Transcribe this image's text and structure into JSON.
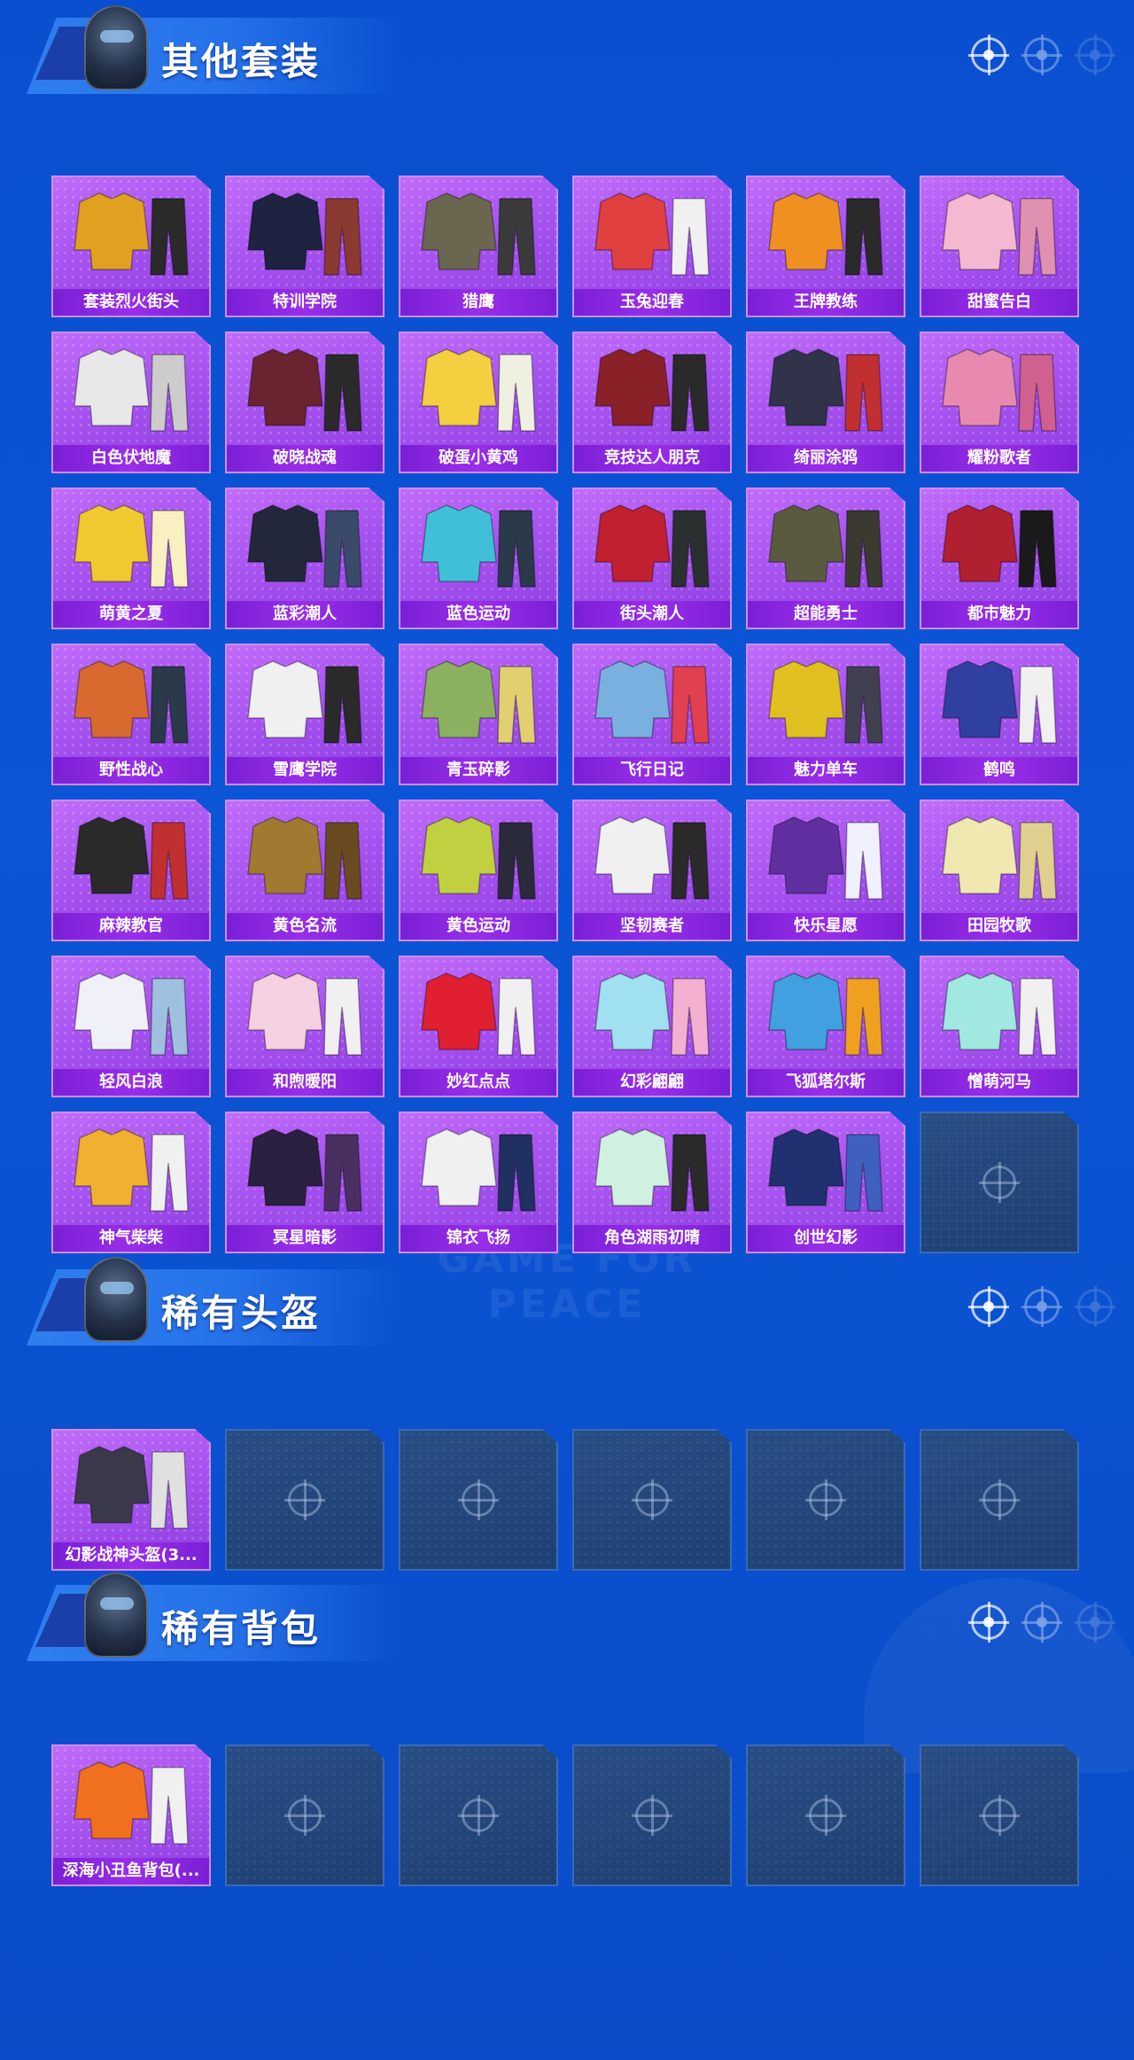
{
  "watermark": "GAME FOR PEACE",
  "sections": [
    {
      "title": "其他套装",
      "items": [
        {
          "name": "套装烈火街头",
          "colors": [
            "#e0a020",
            "#2a2a2a"
          ]
        },
        {
          "name": "特训学院",
          "colors": [
            "#1d2340",
            "#8a3a30"
          ]
        },
        {
          "name": "猎鹰",
          "colors": [
            "#6b6650",
            "#3a3a3a"
          ]
        },
        {
          "name": "玉兔迎春",
          "colors": [
            "#e04040",
            "#f0f0f0"
          ]
        },
        {
          "name": "王牌教练",
          "colors": [
            "#f09020",
            "#2a2a2a"
          ]
        },
        {
          "name": "甜蜜告白",
          "colors": [
            "#f4b8d0",
            "#e090b0"
          ]
        },
        {
          "name": "白色伏地魔",
          "colors": [
            "#e8e8e8",
            "#cccccc"
          ]
        },
        {
          "name": "破晓战魂",
          "colors": [
            "#6a2430",
            "#2a2a2a"
          ]
        },
        {
          "name": "破蛋小黄鸡",
          "colors": [
            "#f4d040",
            "#f0f0e0"
          ]
        },
        {
          "name": "竞技达人朋克",
          "colors": [
            "#8a2028",
            "#2a2a2a"
          ]
        },
        {
          "name": "绮丽涂鸦",
          "colors": [
            "#30334a",
            "#c03030"
          ]
        },
        {
          "name": "耀粉歌者",
          "colors": [
            "#e88ab0",
            "#d06090"
          ]
        },
        {
          "name": "萌黄之夏",
          "colors": [
            "#f0c830",
            "#f8f0c0"
          ]
        },
        {
          "name": "蓝彩潮人",
          "colors": [
            "#22283a",
            "#3a4a6a"
          ]
        },
        {
          "name": "蓝色运动",
          "colors": [
            "#40c0d8",
            "#2a3a4a"
          ]
        },
        {
          "name": "街头潮人",
          "colors": [
            "#c02030",
            "#2a3030"
          ]
        },
        {
          "name": "超能勇士",
          "colors": [
            "#5a5a40",
            "#3a3a30"
          ]
        },
        {
          "name": "都市魅力",
          "colors": [
            "#b02030",
            "#1a1a1a"
          ]
        },
        {
          "name": "野性战心",
          "colors": [
            "#d86a30",
            "#2a3a4a"
          ]
        },
        {
          "name": "雪鹰学院",
          "colors": [
            "#f0f0f0",
            "#2a2a2a"
          ]
        },
        {
          "name": "青玉碎影",
          "colors": [
            "#8ab060",
            "#e0d070"
          ]
        },
        {
          "name": "飞行日记",
          "colors": [
            "#7ab0e0",
            "#e04050"
          ]
        },
        {
          "name": "魅力单车",
          "colors": [
            "#e0c020",
            "#404050"
          ]
        },
        {
          "name": "鹤鸣",
          "colors": [
            "#3040a0",
            "#f0f0f0"
          ]
        },
        {
          "name": "麻辣教官",
          "colors": [
            "#2a2a2a",
            "#c03030"
          ]
        },
        {
          "name": "黄色名流",
          "colors": [
            "#a07a30",
            "#6a4a20"
          ]
        },
        {
          "name": "黄色运动",
          "colors": [
            "#c0d040",
            "#2a2a3a"
          ]
        },
        {
          "name": "坚韧赛者",
          "colors": [
            "#f0f0f0",
            "#2a2a2a"
          ]
        },
        {
          "name": "快乐星愿",
          "colors": [
            "#6030a0",
            "#f0f0ff"
          ]
        },
        {
          "name": "田园牧歌",
          "colors": [
            "#f0e8b0",
            "#e0d090"
          ]
        },
        {
          "name": "轻风白浪",
          "colors": [
            "#f0f0f8",
            "#a0c0e0"
          ]
        },
        {
          "name": "和煦暖阳",
          "colors": [
            "#f4d0e0",
            "#f0f0f0"
          ]
        },
        {
          "name": "妙红点点",
          "colors": [
            "#e02030",
            "#f0f0f0"
          ]
        },
        {
          "name": "幻彩翩翩",
          "colors": [
            "#a0e0f0",
            "#f4b0d0"
          ]
        },
        {
          "name": "飞狐塔尔斯",
          "colors": [
            "#40a0e0",
            "#f0a020"
          ]
        },
        {
          "name": "憎萌河马",
          "colors": [
            "#a0e8e0",
            "#f0f0f0"
          ]
        },
        {
          "name": "神气柴柴",
          "colors": [
            "#f0b030",
            "#f0f0f0"
          ]
        },
        {
          "name": "冥星暗影",
          "colors": [
            "#2a2040",
            "#4a3060"
          ]
        },
        {
          "name": "锦衣飞扬",
          "colors": [
            "#f0f0f0",
            "#203060"
          ]
        },
        {
          "name": "角色湖雨初晴",
          "colors": [
            "#d0f0e0",
            "#2a2a2a"
          ]
        },
        {
          "name": "创世幻影",
          "colors": [
            "#203070",
            "#4060c0"
          ]
        },
        {
          "name": "",
          "colors": []
        }
      ]
    },
    {
      "title": "稀有头盔",
      "items": [
        {
          "name": "幻影战神头盔(3...",
          "colors": [
            "#3a3a4a",
            "#e0e0e0"
          ]
        },
        {
          "name": "",
          "colors": []
        },
        {
          "name": "",
          "colors": []
        },
        {
          "name": "",
          "colors": []
        },
        {
          "name": "",
          "colors": []
        },
        {
          "name": "",
          "colors": []
        }
      ]
    },
    {
      "title": "稀有背包",
      "items": [
        {
          "name": "深海小丑鱼背包(...",
          "colors": [
            "#f07020",
            "#f0f0f0"
          ]
        },
        {
          "name": "",
          "colors": []
        },
        {
          "name": "",
          "colors": []
        },
        {
          "name": "",
          "colors": []
        },
        {
          "name": "",
          "colors": []
        },
        {
          "name": "",
          "colors": []
        }
      ]
    }
  ]
}
